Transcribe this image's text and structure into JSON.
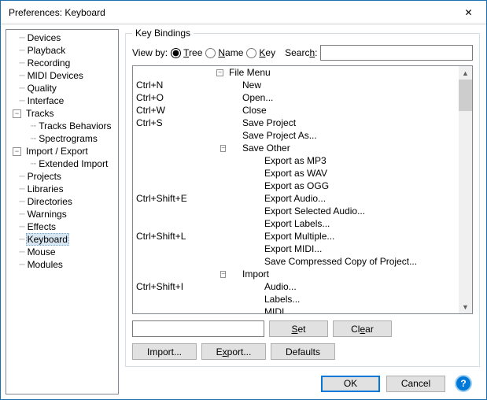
{
  "title": "Preferences: Keyboard",
  "sidebar": {
    "items": [
      {
        "label": "Devices",
        "indent": 1,
        "toggle": null
      },
      {
        "label": "Playback",
        "indent": 1,
        "toggle": null
      },
      {
        "label": "Recording",
        "indent": 1,
        "toggle": null
      },
      {
        "label": "MIDI Devices",
        "indent": 1,
        "toggle": null
      },
      {
        "label": "Quality",
        "indent": 1,
        "toggle": null
      },
      {
        "label": "Interface",
        "indent": 1,
        "toggle": null
      },
      {
        "label": "Tracks",
        "indent": 0,
        "toggle": "-"
      },
      {
        "label": "Tracks Behaviors",
        "indent": 2,
        "toggle": null
      },
      {
        "label": "Spectrograms",
        "indent": 2,
        "toggle": null
      },
      {
        "label": "Import / Export",
        "indent": 0,
        "toggle": "-"
      },
      {
        "label": "Extended Import",
        "indent": 2,
        "toggle": null
      },
      {
        "label": "Projects",
        "indent": 1,
        "toggle": null
      },
      {
        "label": "Libraries",
        "indent": 1,
        "toggle": null
      },
      {
        "label": "Directories",
        "indent": 1,
        "toggle": null
      },
      {
        "label": "Warnings",
        "indent": 1,
        "toggle": null
      },
      {
        "label": "Effects",
        "indent": 1,
        "toggle": null
      },
      {
        "label": "Keyboard",
        "indent": 1,
        "toggle": null,
        "selected": true
      },
      {
        "label": "Mouse",
        "indent": 1,
        "toggle": null
      },
      {
        "label": "Modules",
        "indent": 1,
        "toggle": null
      }
    ]
  },
  "group_title": "Key Bindings",
  "viewby": {
    "label_prefix": "View by:",
    "opt_tree": "Tree",
    "opt_name": "Name",
    "opt_key": "Key",
    "search_label": "Search:"
  },
  "bindings": [
    {
      "key": "",
      "name": "File Menu",
      "level": 0,
      "expand": "-"
    },
    {
      "key": "Ctrl+N",
      "name": "New",
      "level": 1
    },
    {
      "key": "Ctrl+O",
      "name": "Open...",
      "level": 1
    },
    {
      "key": "Ctrl+W",
      "name": "Close",
      "level": 1
    },
    {
      "key": "Ctrl+S",
      "name": "Save Project",
      "level": 1
    },
    {
      "key": "",
      "name": "Save Project As...",
      "level": 1
    },
    {
      "key": "",
      "name": "Save Other",
      "level": 1,
      "expand": "-"
    },
    {
      "key": "",
      "name": "Export as MP3",
      "level": 2
    },
    {
      "key": "",
      "name": "Export as WAV",
      "level": 2
    },
    {
      "key": "",
      "name": "Export as OGG",
      "level": 2
    },
    {
      "key": "Ctrl+Shift+E",
      "name": "Export Audio...",
      "level": 2
    },
    {
      "key": "",
      "name": "Export Selected Audio...",
      "level": 2
    },
    {
      "key": "",
      "name": "Export Labels...",
      "level": 2
    },
    {
      "key": "Ctrl+Shift+L",
      "name": "Export Multiple...",
      "level": 2
    },
    {
      "key": "",
      "name": "Export MIDI...",
      "level": 2
    },
    {
      "key": "",
      "name": "Save Compressed Copy of Project...",
      "level": 2
    },
    {
      "key": "",
      "name": "Import",
      "level": 1,
      "expand": "-"
    },
    {
      "key": "Ctrl+Shift+I",
      "name": "Audio...",
      "level": 2
    },
    {
      "key": "",
      "name": "Labels...",
      "level": 2
    },
    {
      "key": "",
      "name": "MIDI",
      "level": 2
    }
  ],
  "buttons": {
    "set": "Set",
    "clear": "Clear",
    "import": "Import...",
    "export": "Export...",
    "defaults": "Defaults",
    "ok": "OK",
    "cancel": "Cancel"
  }
}
